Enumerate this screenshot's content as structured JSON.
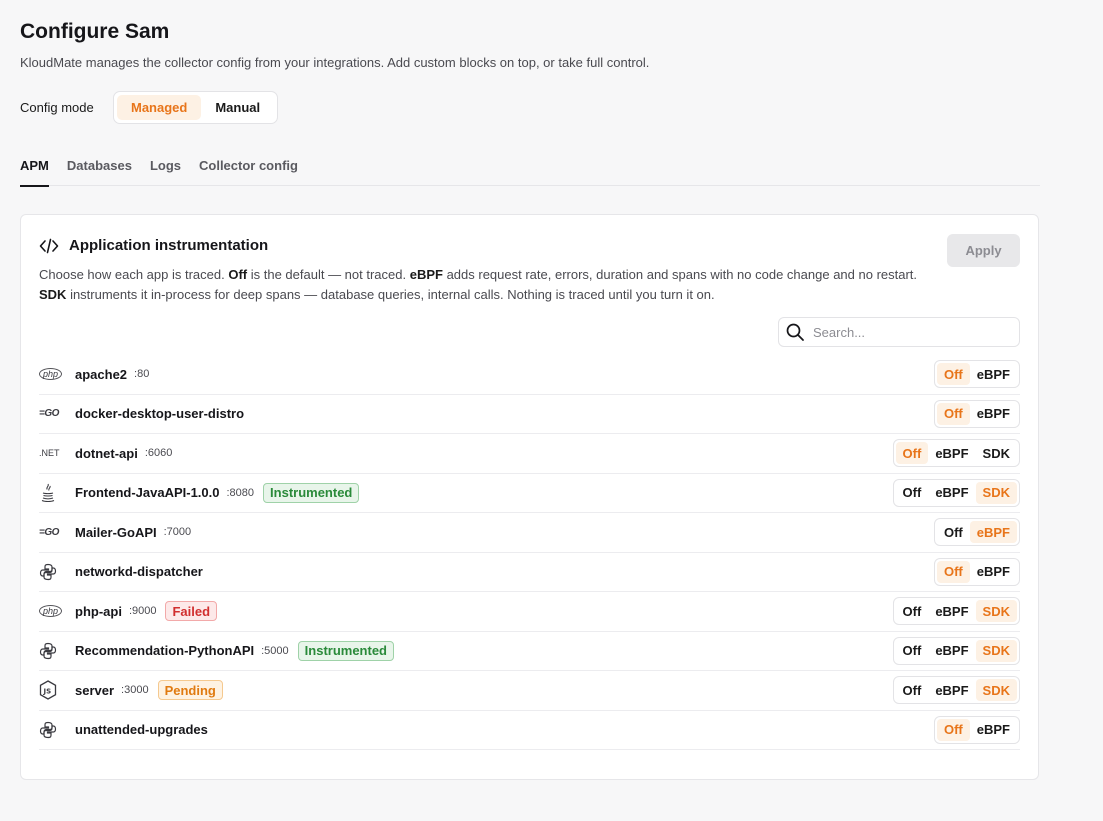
{
  "page": {
    "title": "Configure Sam",
    "subtitle": "KloudMate manages the collector config from your integrations. Add custom blocks on top, or take full control."
  },
  "config_mode": {
    "label": "Config mode",
    "options": [
      "Managed",
      "Manual"
    ],
    "selected": "Managed"
  },
  "tabs": [
    {
      "label": "APM",
      "active": true
    },
    {
      "label": "Databases",
      "active": false
    },
    {
      "label": "Logs",
      "active": false
    },
    {
      "label": "Collector config",
      "active": false
    }
  ],
  "card": {
    "title": "Application instrumentation",
    "apply_label": "Apply",
    "desc": {
      "p1": "Choose how each app is traced. ",
      "b1": "Off",
      "p2": " is the default — not traced. ",
      "b2": "eBPF",
      "p3": " adds request rate, errors, duration and spans with no code change and no restart. ",
      "b3": "SDK",
      "p4": " instruments it in-process for deep spans — database queries, internal calls. Nothing is traced until you turn it on."
    },
    "search_placeholder": "Search..."
  },
  "services": [
    {
      "name": "apache2",
      "port": ":80",
      "lang": "php",
      "icon": "php-icon",
      "badge": "",
      "options": [
        "Off",
        "eBPF"
      ],
      "selected": "Off"
    },
    {
      "name": "docker-desktop-user-distro",
      "port": "",
      "lang": "go",
      "icon": "go-icon",
      "badge": "",
      "options": [
        "Off",
        "eBPF"
      ],
      "selected": "Off"
    },
    {
      "name": "dotnet-api",
      "port": ":6060",
      "lang": "net",
      "icon": "dotnet-icon",
      "badge": "",
      "options": [
        "Off",
        "eBPF",
        "SDK"
      ],
      "selected": "Off"
    },
    {
      "name": "Frontend-JavaAPI-1.0.0",
      "port": ":8080",
      "lang": "java",
      "icon": "java-icon",
      "badge": "Instrumented",
      "badge_type": "instrumented",
      "options": [
        "Off",
        "eBPF",
        "SDK"
      ],
      "selected": "SDK"
    },
    {
      "name": "Mailer-GoAPI",
      "port": ":7000",
      "lang": "go",
      "icon": "go-icon",
      "badge": "",
      "options": [
        "Off",
        "eBPF"
      ],
      "selected": "eBPF"
    },
    {
      "name": "networkd-dispatcher",
      "port": "",
      "lang": "python",
      "icon": "python-icon",
      "badge": "",
      "options": [
        "Off",
        "eBPF"
      ],
      "selected": "Off"
    },
    {
      "name": "php-api",
      "port": ":9000",
      "lang": "php",
      "icon": "php-icon",
      "badge": "Failed",
      "badge_type": "failed",
      "options": [
        "Off",
        "eBPF",
        "SDK"
      ],
      "selected": "SDK"
    },
    {
      "name": "Recommendation-PythonAPI",
      "port": ":5000",
      "lang": "python",
      "icon": "python-icon",
      "badge": "Instrumented",
      "badge_type": "instrumented",
      "options": [
        "Off",
        "eBPF",
        "SDK"
      ],
      "selected": "SDK"
    },
    {
      "name": "server",
      "port": ":3000",
      "lang": "node",
      "icon": "nodejs-icon",
      "badge": "Pending",
      "badge_type": "pending",
      "options": [
        "Off",
        "eBPF",
        "SDK"
      ],
      "selected": "SDK"
    },
    {
      "name": "unattended-upgrades",
      "port": "",
      "lang": "python",
      "icon": "python-icon",
      "badge": "",
      "options": [
        "Off",
        "eBPF"
      ],
      "selected": "Off"
    }
  ],
  "colors": {
    "accent": "#e8751a",
    "accent_bg": "#fdf1e4",
    "success": "#2a8a3a",
    "danger": "#d12f2f",
    "warning": "#e07a10"
  }
}
